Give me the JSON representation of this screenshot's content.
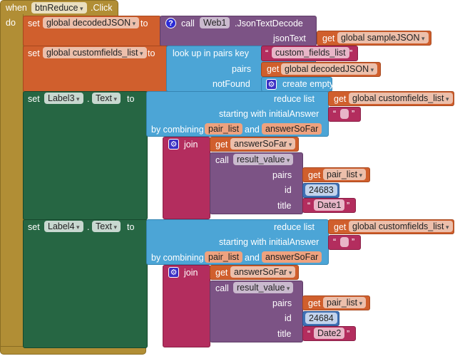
{
  "event": {
    "when": "when",
    "component": "btnReduce",
    "event": ".Click",
    "do": "do"
  },
  "set_decoded": {
    "set": "set",
    "variable": "global decodedJSON",
    "to": "to",
    "call": "call",
    "component": "Web1",
    "method": ".JsonTextDecode",
    "param": "jsonText",
    "get": "get",
    "value": "global sampleJSON"
  },
  "set_custom": {
    "set": "set",
    "variable": "global customfields_list",
    "to": "to",
    "lookup": "look up in pairs  key",
    "key": "custom_fields_list",
    "pairs": "pairs",
    "get": "get",
    "pairs_value": "global decodedJSON",
    "notfound": "notFound",
    "empty_list": "create empty list"
  },
  "quotes": {
    "open": "“",
    "close": "”"
  },
  "labels": [
    {
      "set": "set",
      "component": "Label3",
      "dot": ".",
      "property": "Text",
      "to": "to",
      "reduce": "reduce  list",
      "get": "get",
      "list": "global customfields_list",
      "starting": "starting with initialAnswer",
      "combining": "by combining",
      "item": "pair_list",
      "and": "and",
      "acc": "answerSoFar",
      "join": "join",
      "get_acc": "answerSoFar",
      "call": "call",
      "procedure": "result_value",
      "pairs": "pairs",
      "pairs_value": "pair_list",
      "id": "id",
      "id_value": "24683",
      "title": "title",
      "title_value": "Date1"
    },
    {
      "set": "set",
      "component": "Label4",
      "dot": ".",
      "property": "Text",
      "to": "to",
      "reduce": "reduce  list",
      "get": "get",
      "list": "global customfields_list",
      "starting": "starting with initialAnswer",
      "combining": "by combining",
      "item": "pair_list",
      "and": "and",
      "acc": "answerSoFar",
      "join": "join",
      "get_acc": "answerSoFar",
      "call": "call",
      "procedure": "result_value",
      "pairs": "pairs",
      "pairs_value": "pair_list",
      "id": "id",
      "id_value": "24684",
      "title": "title",
      "title_value": "Date2"
    }
  ]
}
